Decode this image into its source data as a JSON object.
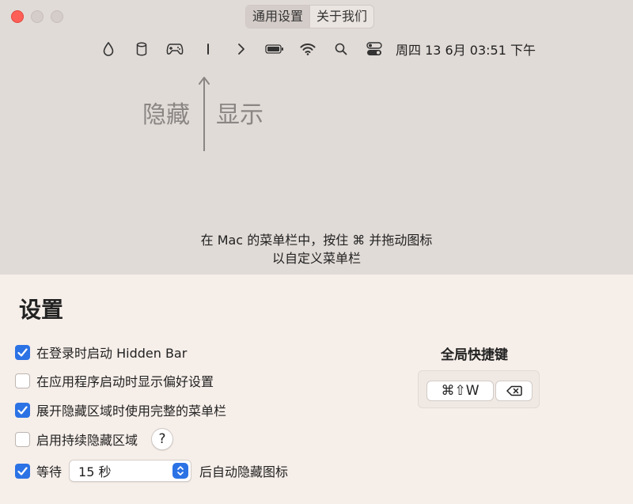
{
  "window": {
    "tabs": [
      {
        "label": "通用设置",
        "active": true
      },
      {
        "label": "关于我们",
        "active": false
      }
    ]
  },
  "menubar": {
    "icons": [
      "drop-icon",
      "cylinder-icon",
      "gamepad-icon",
      "separator-bar-icon",
      "chevron-right-icon",
      "battery-icon",
      "wifi-icon",
      "search-icon",
      "control-center-icon"
    ],
    "clock": "周四 13 6月 03:51 下午"
  },
  "demo": {
    "hide_label": "隐藏",
    "show_label": "显示",
    "tip_line1": "在 Mac 的菜单栏中，按住 ⌘ 并拖动图标",
    "tip_line2": "以自定义菜单栏"
  },
  "settings": {
    "title": "设置",
    "options": [
      {
        "label": "在登录时启动 Hidden Bar",
        "checked": true
      },
      {
        "label": "在应用程序启动时显示偏好设置",
        "checked": false
      },
      {
        "label": "展开隐藏区域时使用完整的菜单栏",
        "checked": true
      },
      {
        "label": "启用持续隐藏区域",
        "checked": false,
        "help": "?"
      },
      {
        "label_before": "等待",
        "select_value": "15 秒",
        "label_after": "后自动隐藏图标",
        "checked": true
      }
    ]
  },
  "shortcut": {
    "title": "全局快捷键",
    "keys": "⌘⇧W"
  },
  "colors": {
    "accent": "#2b72e5",
    "close": "#fe5f57"
  }
}
